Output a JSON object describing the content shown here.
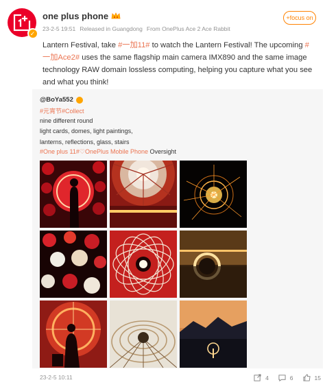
{
  "header": {
    "user_name": "one plus phone",
    "time": "23-2-5 19:51",
    "location": "Released in Guangdong",
    "source": "From OnePlus Ace 2 Ace Rabbit",
    "follow_label": "+focus on"
  },
  "post": {
    "text_1": "Lantern Festival, take ",
    "tag_1": "#一加11#",
    "text_2": " to watch the Lantern Festival! The upcoming ",
    "tag_2": "#一加Ace2#",
    "text_3": " uses the same flagship main camera IMX890 and the same image technology RAW domain lossless computing, helping you capture what you see and what you think!"
  },
  "repost": {
    "author": "@BoYa552",
    "tags": "#元宵节#Collect",
    "line_1": " nine different round",
    "line_2": "light cards, domes, light paintings,",
    "line_3": "lanterns, reflections, glass, stairs",
    "tag_phone": "#One plus 11#",
    "tag_mobile": "OnePlus Mobile Phone",
    "oversight": " Oversight",
    "time": "23-2-5 10:11",
    "repost_count": "4",
    "comment_count": "6",
    "like_count": "15"
  },
  "colors": {
    "brand_red": "#eb0029",
    "tag_orange": "#eb7350",
    "follow_orange": "#ff8200",
    "meta_gray": "#939393"
  },
  "icons": [
    "oneplus-logo-icon",
    "verified-icon",
    "crown-icon",
    "repost-icon",
    "comment-icon",
    "like-icon"
  ]
}
